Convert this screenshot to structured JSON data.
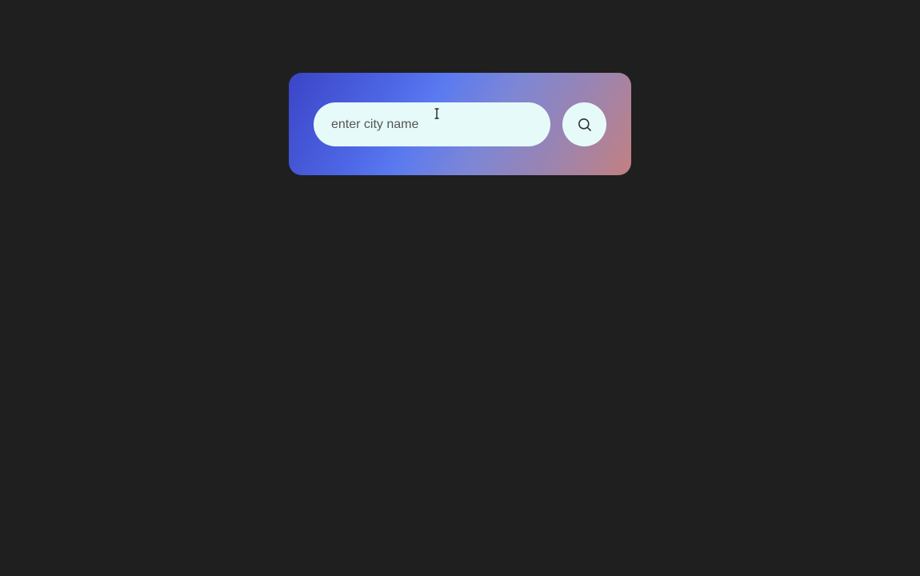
{
  "search": {
    "placeholder": "enter city name",
    "value": "",
    "button_icon": "search-icon"
  },
  "colors": {
    "background": "#1f1f1f",
    "card_gradient": [
      "#3a45c6",
      "#5a7af0",
      "#9b84b0",
      "#c38081"
    ],
    "input_background": "#e6fbf9"
  }
}
